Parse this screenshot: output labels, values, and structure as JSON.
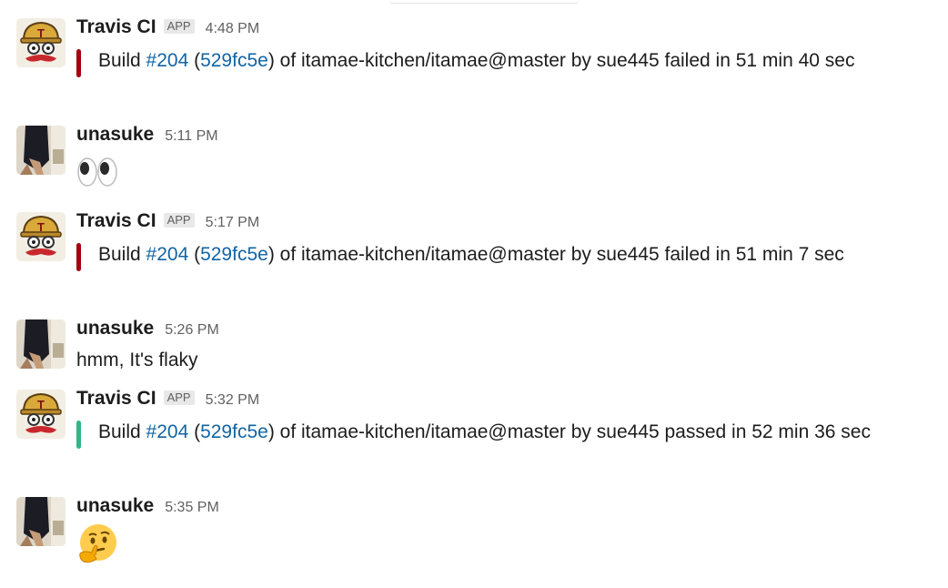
{
  "colors": {
    "failed": "#a4000f",
    "passed": "#2eb886",
    "link": "#1264a3"
  },
  "messages": [
    {
      "sender": "Travis CI",
      "app_badge": "APP",
      "time": "4:48 PM",
      "build": {
        "prefix": "Build ",
        "number": "#204",
        "open": " (",
        "commit": "529fc5e",
        "close": ")",
        "rest": " of itamae-kitchen/itamae@master by sue445 failed in 51 min 40 sec",
        "status": "failed"
      }
    },
    {
      "sender": "unasuke",
      "time": "5:11 PM",
      "emoji": "eyes-emoji"
    },
    {
      "sender": "Travis CI",
      "app_badge": "APP",
      "time": "5:17 PM",
      "build": {
        "prefix": "Build ",
        "number": "#204",
        "open": " (",
        "commit": "529fc5e",
        "close": ")",
        "rest": " of itamae-kitchen/itamae@master by sue445 failed in 51 min 7 sec",
        "status": "failed"
      }
    },
    {
      "sender": "unasuke",
      "time": "5:26 PM",
      "text": "hmm, It's flaky"
    },
    {
      "sender": "Travis CI",
      "app_badge": "APP",
      "time": "5:32 PM",
      "build": {
        "prefix": "Build ",
        "number": "#204",
        "open": " (",
        "commit": "529fc5e",
        "close": ")",
        "rest": " of itamae-kitchen/itamae@master by sue445 passed in 52 min 36 sec",
        "status": "passed"
      }
    },
    {
      "sender": "unasuke",
      "time": "5:35 PM",
      "emoji": "thinking-face-emoji"
    }
  ]
}
